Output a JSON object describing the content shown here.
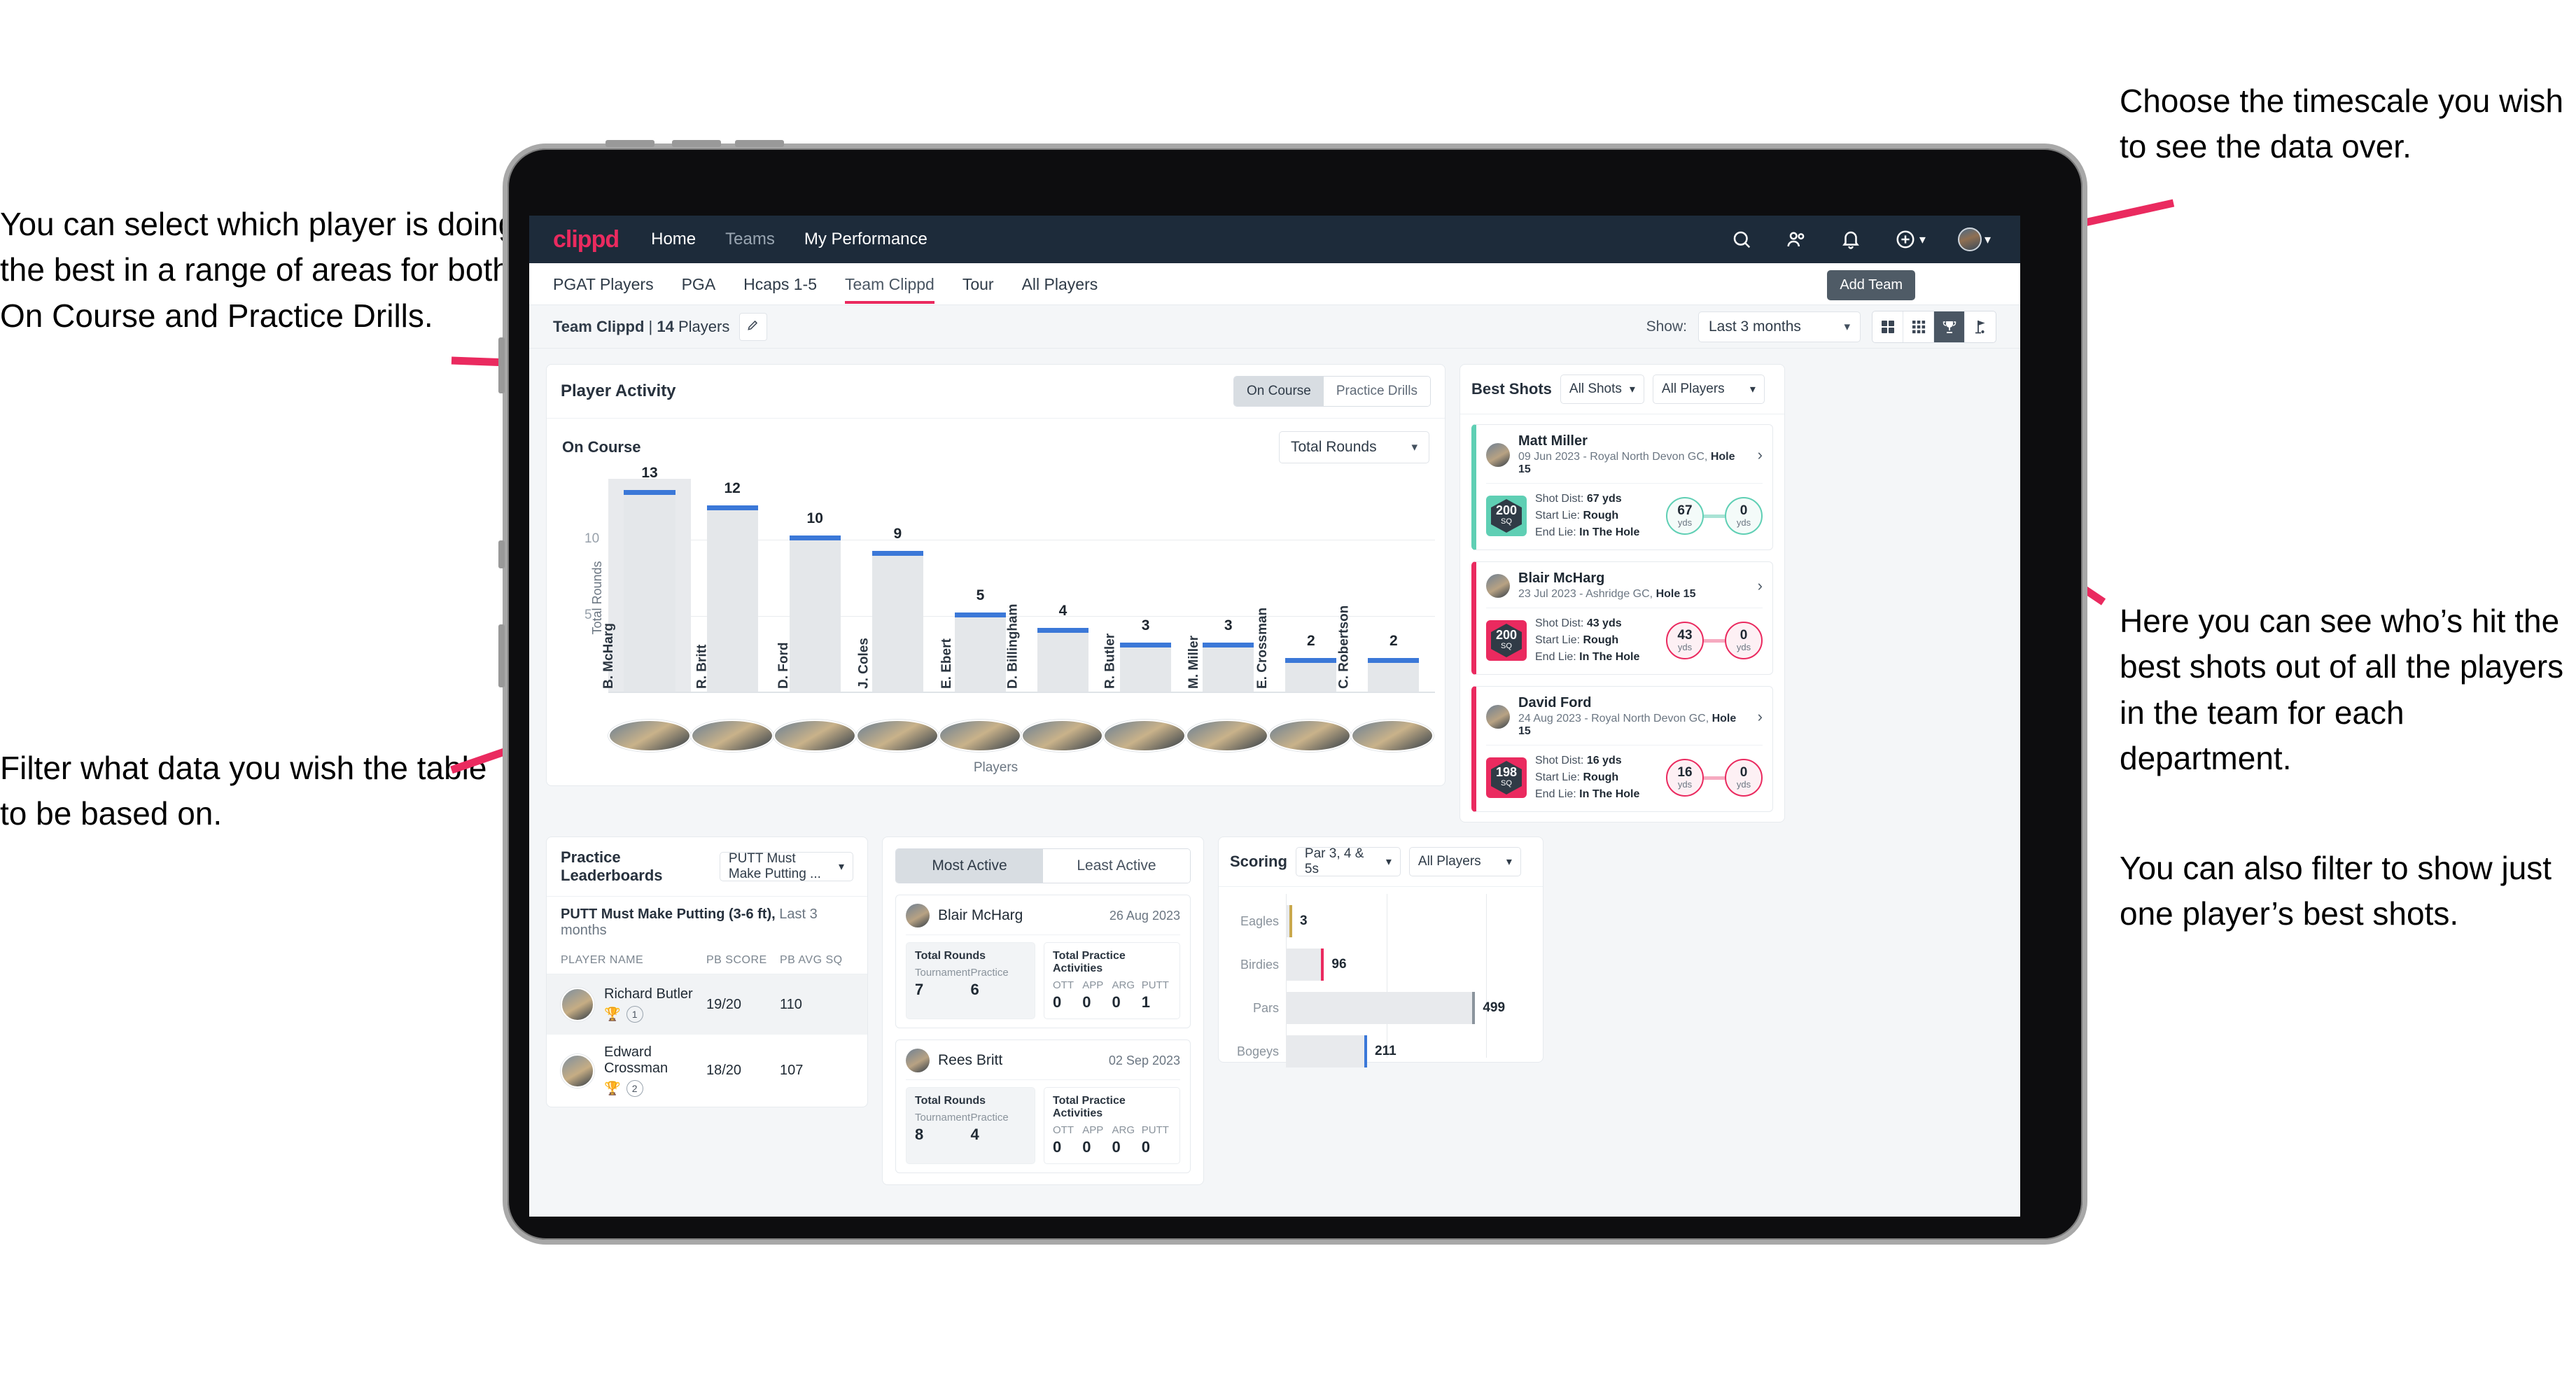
{
  "annotations": {
    "left_top": "You can select which player is doing the best in a range of areas for both On Course and Practice Drills.",
    "left_bottom": "Filter what data you wish the table to be based on.",
    "right_top": "Choose the timescale you wish to see the data over.",
    "right_middle": "Here you can see who’s hit the best shots out of all the players in the team for each department.",
    "right_bottom": "You can also filter to show just one player’s best shots."
  },
  "topnav": {
    "brand": "clippd",
    "links": [
      {
        "label": "Home",
        "active": true
      },
      {
        "label": "Teams",
        "active": false
      },
      {
        "label": "My Performance",
        "active": true
      }
    ],
    "icons": [
      "search-icon",
      "people-icon",
      "bell-icon",
      "plus-circle-icon",
      "avatar"
    ]
  },
  "tabs": [
    {
      "label": "PGAT Players",
      "active": false
    },
    {
      "label": "PGA",
      "active": false
    },
    {
      "label": "Hcaps 1-5",
      "active": false
    },
    {
      "label": "Team Clippd",
      "active": true
    },
    {
      "label": "Tour",
      "active": false
    },
    {
      "label": "All Players",
      "active": false
    }
  ],
  "tooltip": {
    "add_team": "Add Team"
  },
  "subbar": {
    "team_name": "Team Clippd",
    "separator": "|",
    "player_count": "14",
    "players_word": "Players",
    "edit_icon": "pencil-icon",
    "show_label": "Show:",
    "timescale_value": "Last 3 months",
    "view_toggles": [
      {
        "icon": "grid-large-icon",
        "active": false
      },
      {
        "icon": "grid-small-icon",
        "active": false
      },
      {
        "icon": "trophy-icon",
        "active": true
      },
      {
        "icon": "flag-icon",
        "active": false
      }
    ]
  },
  "player_activity": {
    "title": "Player Activity",
    "segments": [
      {
        "label": "On Course",
        "active": true
      },
      {
        "label": "Practice Drills",
        "active": false
      }
    ],
    "sub_label": "On Course",
    "metric_dropdown": "Total Rounds"
  },
  "chart_data": [
    {
      "type": "bar",
      "title": "Player Activity — On Course",
      "xlabel": "Players",
      "ylabel": "Total Rounds",
      "ylim": [
        0,
        14
      ],
      "yticks": [
        5,
        10
      ],
      "grid": true,
      "categories": [
        "B. McHarg",
        "R. Britt",
        "D. Ford",
        "J. Coles",
        "E. Ebert",
        "D. Billingham",
        "R. Butler",
        "M. Miller",
        "E. Crossman",
        "C. Robertson"
      ],
      "values": [
        13,
        12,
        10,
        9,
        5,
        4,
        3,
        3,
        2,
        2
      ]
    },
    {
      "type": "bar",
      "orientation": "horizontal",
      "title": "Scoring",
      "categories": [
        "Eagles",
        "Birdies",
        "Pars",
        "Bogeys"
      ],
      "values": [
        3,
        96,
        499,
        211
      ],
      "xlim": [
        0,
        560
      ],
      "colors": [
        "#c9a84c",
        "#ea2a5f",
        "#8b949d",
        "#3b78d8"
      ]
    }
  ],
  "best_shots": {
    "title": "Best Shots",
    "shot_filter": "All Shots",
    "player_filter": "All Players",
    "items": [
      {
        "accent": "teal",
        "name": "Matt Miller",
        "meta_date": "09 Jun 2023 - Royal North Devon GC,",
        "meta_hole": "Hole 15",
        "badge_value": "200",
        "badge_unit": "SQ",
        "shot_dist_label": "Shot Dist:",
        "shot_dist_value": "67 yds",
        "start_lie_label": "Start Lie:",
        "start_lie_value": "Rough",
        "end_lie_label": "End Lie:",
        "end_lie_value": "In The Hole",
        "from_value": "67",
        "from_unit": "yds",
        "to_value": "0",
        "to_unit": "yds"
      },
      {
        "accent": "pink",
        "name": "Blair McHarg",
        "meta_date": "23 Jul 2023 - Ashridge GC,",
        "meta_hole": "Hole 15",
        "badge_value": "200",
        "badge_unit": "SQ",
        "shot_dist_label": "Shot Dist:",
        "shot_dist_value": "43 yds",
        "start_lie_label": "Start Lie:",
        "start_lie_value": "Rough",
        "end_lie_label": "End Lie:",
        "end_lie_value": "In The Hole",
        "from_value": "43",
        "from_unit": "yds",
        "to_value": "0",
        "to_unit": "yds"
      },
      {
        "accent": "pink",
        "name": "David Ford",
        "meta_date": "24 Aug 2023 - Royal North Devon GC,",
        "meta_hole": "Hole 15",
        "badge_value": "198",
        "badge_unit": "SQ",
        "shot_dist_label": "Shot Dist:",
        "shot_dist_value": "16 yds",
        "start_lie_label": "Start Lie:",
        "start_lie_value": "Rough",
        "end_lie_label": "End Lie:",
        "end_lie_value": "In The Hole",
        "from_value": "16",
        "from_unit": "yds",
        "to_value": "0",
        "to_unit": "yds"
      }
    ]
  },
  "practice": {
    "title": "Practice Leaderboards",
    "dropdown": "PUTT Must Make Putting ...",
    "subtitle_bold": "PUTT Must Make Putting (3-6 ft),",
    "subtitle_light": "Last 3 months",
    "columns": [
      "PLAYER NAME",
      "PB SCORE",
      "PB AVG SQ"
    ],
    "rows": [
      {
        "name": "Richard Butler",
        "rank": "1",
        "trophy": "gold",
        "pb_score": "19/20",
        "pb_avg_sq": "110"
      },
      {
        "name": "Edward Crossman",
        "rank": "2",
        "trophy": "silver",
        "pb_score": "18/20",
        "pb_avg_sq": "107"
      }
    ]
  },
  "activity_panel": {
    "tabs": [
      {
        "label": "Most Active",
        "active": true
      },
      {
        "label": "Least Active",
        "active": false
      }
    ],
    "rounds_title": "Total Rounds",
    "rounds_cols": [
      "Tournament",
      "Practice"
    ],
    "practice_title": "Total Practice Activities",
    "practice_cols": [
      "OTT",
      "APP",
      "ARG",
      "PUTT"
    ],
    "cards": [
      {
        "name": "Blair McHarg",
        "date": "26 Aug 2023",
        "tournament": "7",
        "practice": "6",
        "ott": "0",
        "app": "0",
        "arg": "0",
        "putt": "1"
      },
      {
        "name": "Rees Britt",
        "date": "02 Sep 2023",
        "tournament": "8",
        "practice": "4",
        "ott": "0",
        "app": "0",
        "arg": "0",
        "putt": "0"
      }
    ]
  },
  "scoring": {
    "title": "Scoring",
    "par_filter": "Par 3, 4 & 5s",
    "player_filter": "All Players",
    "rows": [
      {
        "label": "Eagles",
        "value": "3"
      },
      {
        "label": "Birdies",
        "value": "96"
      },
      {
        "label": "Pars",
        "value": "499"
      },
      {
        "label": "Bogeys",
        "value": "211"
      }
    ]
  },
  "colors": {
    "brand_pink": "#ea2a5f",
    "nav_dark": "#1d2b3a",
    "bar_blue": "#3b78d8",
    "teal": "#5fcfb4"
  }
}
